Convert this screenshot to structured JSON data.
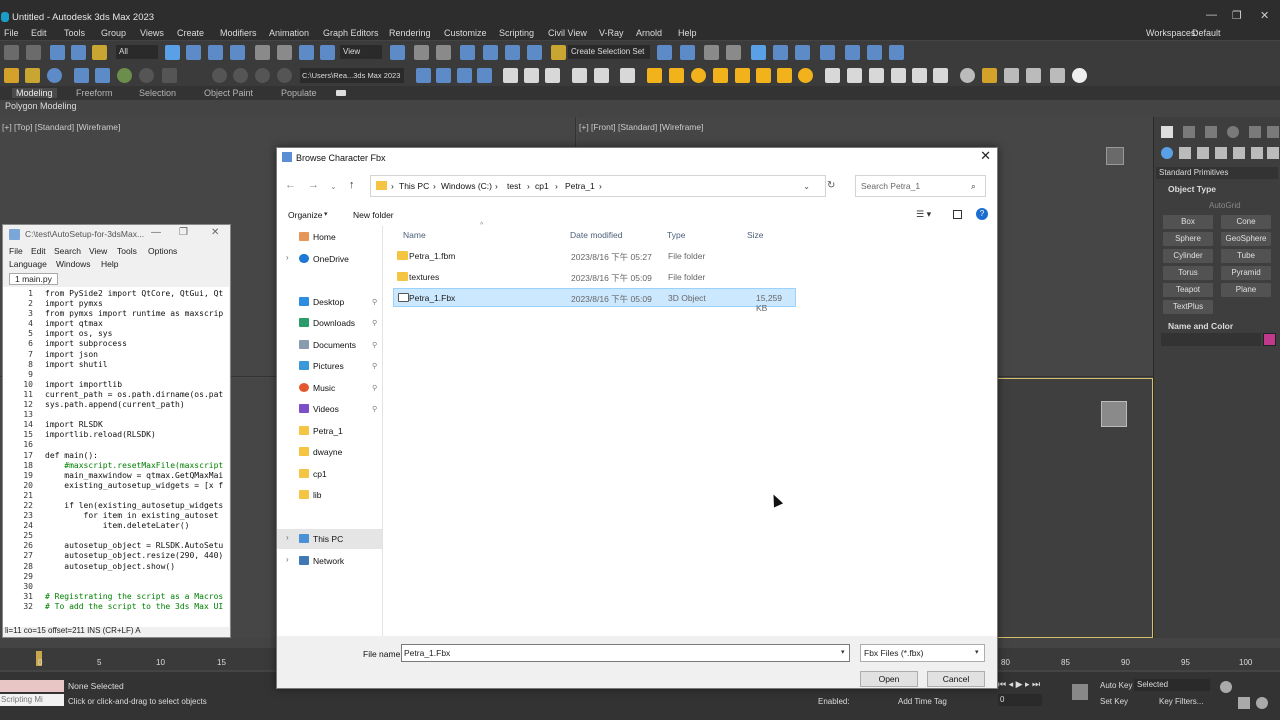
{
  "app": {
    "title": "Untitled - Autodesk 3ds Max 2023",
    "menu": [
      "File",
      "Edit",
      "Tools",
      "Group",
      "Views",
      "Create",
      "Modifiers",
      "Animation",
      "Graph Editors",
      "Rendering",
      "Customize",
      "Scripting",
      "Civil View",
      "V-Ray",
      "Arnold",
      "Help"
    ],
    "workspaces_label": "Workspaces:",
    "workspaces_value": "Default",
    "selection_filter": "All",
    "view_dropdown": "View",
    "selection_set": "Create Selection Set",
    "path_field": "C:\\Users\\Rea...3ds Max 2023",
    "ribbon_tabs": [
      "Modeling",
      "Freeform",
      "Selection",
      "Object Paint",
      "Populate"
    ],
    "polygon_modeling": "Polygon Modeling",
    "viewport_top": "[+] [Top] [Standard] [Wireframe]",
    "viewport_front": "[+] [Front] [Standard] [Wireframe]"
  },
  "command_panel": {
    "dropdown": "Standard Primitives",
    "object_type": "Object Type",
    "autogrid": "AutoGrid",
    "buttons": [
      "Box",
      "Cone",
      "Sphere",
      "GeoSphere",
      "Cylinder",
      "Tube",
      "Torus",
      "Pyramid",
      "Teapot",
      "Plane",
      "TextPlus"
    ],
    "name_and_color": "Name and Color"
  },
  "timeline": {
    "ticks": [
      "0",
      "5",
      "10",
      "15",
      "80",
      "85",
      "90",
      "95",
      "100"
    ],
    "slider": "0 / 100"
  },
  "status": {
    "selection": "None Selected",
    "hint": "Click or click-and-drag to select objects",
    "maxscript": "Scripting Mi",
    "enabled_label": "Enabled:",
    "add_time_tag": "Add Time Tag",
    "auto_key": "Auto Key",
    "set_key": "Set Key",
    "selected": "Selected",
    "key_filters": "Key Filters...",
    "frame": "0"
  },
  "editor": {
    "title": "C:\\test\\AutoSetup-for-3dsMax...",
    "menu1": [
      "File",
      "Edit",
      "Search",
      "View",
      "Tools",
      "Options"
    ],
    "menu2": [
      "Language",
      "Windows",
      "Help"
    ],
    "tab": "1 main.py",
    "line_numbers": [
      "1",
      "2",
      "3",
      "4",
      "5",
      "6",
      "7",
      "8",
      "9",
      "10",
      "11",
      "12",
      "13",
      "14",
      "15",
      "16",
      "17",
      "18",
      "19",
      "20",
      "21",
      "22",
      "23",
      "24",
      "25",
      "26",
      "27",
      "28",
      "29",
      "30",
      "31",
      "32"
    ],
    "lines": [
      "from PySide2 import QtCore, QtGui, Qt",
      "import pymxs",
      "from pymxs import runtime as maxscrip",
      "import qtmax",
      "import os, sys",
      "import subprocess",
      "import json",
      "import shutil",
      "",
      "import importlib",
      "current_path = os.path.dirname(os.pat",
      "sys.path.append(current_path)",
      "",
      "import RLSDK",
      "importlib.reload(RLSDK)",
      "",
      "def main():",
      "    #maxscript.resetMaxFile(maxscript",
      "    main_maxwindow = qtmax.GetQMaxMai",
      "    existing_autosetup_widgets = [x f",
      "",
      "    if len(existing_autosetup_widgets",
      "        for item in existing_autoset",
      "            item.deleteLater()",
      "",
      "    autosetup_object = RLSDK.AutoSetu",
      "    autosetup_object.resize(290, 440)",
      "    autosetup_object.show()",
      "",
      "",
      "# Registrating the script as a Macros",
      "# To add the script to the 3ds Max UI"
    ],
    "status": "li=11 co=15 offset=211 INS (CR+LF) A"
  },
  "dialog": {
    "title": "Browse Character Fbx",
    "path": [
      "This PC",
      "Windows (C:)",
      "test",
      "cp1",
      "Petra_1"
    ],
    "search_placeholder": "Search Petra_1",
    "organize": "Organize",
    "new_folder": "New folder",
    "nav": {
      "quick": [
        "Home",
        "OneDrive"
      ],
      "pinned": [
        "Desktop",
        "Downloads",
        "Documents",
        "Pictures",
        "Music",
        "Videos"
      ],
      "folders": [
        "Petra_1",
        "dwayne",
        "cp1",
        "lib"
      ],
      "this_pc": "This PC",
      "network": "Network"
    },
    "columns": [
      "Name",
      "Date modified",
      "Type",
      "Size"
    ],
    "files": [
      {
        "name": "Petra_1.fbm",
        "date": "2023/8/16 下午 05:27",
        "type": "File folder",
        "size": ""
      },
      {
        "name": "textures",
        "date": "2023/8/16 下午 05:09",
        "type": "File folder",
        "size": ""
      },
      {
        "name": "Petra_1.Fbx",
        "date": "2023/8/16 下午 05:09",
        "type": "3D Object",
        "size": "15,259 KB"
      }
    ],
    "file_name_label": "File name:",
    "file_name_value": "Petra_1.Fbx",
    "file_type": "Fbx Files (*.fbx)",
    "open": "Open",
    "cancel": "Cancel"
  },
  "colors": {
    "accent_select": "#cce8ff",
    "max_bg": "#444444",
    "name_color_swatch": "#c0398a"
  }
}
